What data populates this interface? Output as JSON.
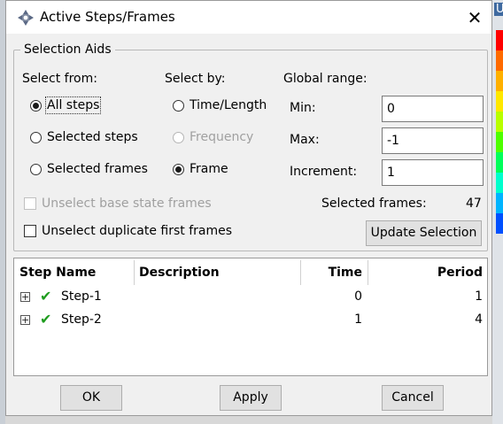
{
  "colors": {
    "accent": "#3f6aa0",
    "check_green": "#1f9d1f"
  },
  "background": {
    "partial_label": "U",
    "legend_colors": [
      "#ff0000",
      "#ff6a00",
      "#ffb000",
      "#ffe800",
      "#b8ff00",
      "#4dff00",
      "#00ff5a",
      "#00ffcc",
      "#00b4ff",
      "#0050ff"
    ]
  },
  "dialog": {
    "title": "Active Steps/Frames",
    "title_icon": "abaqus-app-icon",
    "close_icon": "close-icon",
    "group_title": "Selection Aids",
    "select_from": {
      "heading": "Select from:",
      "options": [
        {
          "label": "All steps",
          "checked": true
        },
        {
          "label": "Selected steps",
          "checked": false
        },
        {
          "label": "Selected frames",
          "checked": false
        }
      ]
    },
    "select_by": {
      "heading": "Select by:",
      "options": [
        {
          "label": "Time/Length",
          "checked": false,
          "enabled": true
        },
        {
          "label": "Frequency",
          "checked": false,
          "enabled": false
        },
        {
          "label": "Frame",
          "checked": true,
          "enabled": true
        }
      ]
    },
    "global_range": {
      "heading": "Global range:",
      "min_label": "Min:",
      "min_value": "0",
      "max_label": "Max:",
      "max_value": "-1",
      "increment_label": "Increment:",
      "increment_value": "1"
    },
    "unselect_base": {
      "label": "Unselect base state frames",
      "checked": false,
      "enabled": false
    },
    "unselect_duplicate": {
      "label": "Unselect duplicate first frames",
      "checked": false
    },
    "selected_frames_label": "Selected frames:",
    "selected_frames_count": "47",
    "update_button": "Update Selection",
    "table": {
      "columns": [
        "Step Name",
        "Description",
        "Time",
        "Period"
      ],
      "rows": [
        {
          "name": "Step-1",
          "description": "",
          "time": "0",
          "period": "1"
        },
        {
          "name": "Step-2",
          "description": "",
          "time": "1",
          "period": "4"
        }
      ]
    },
    "buttons": {
      "ok": "OK",
      "apply": "Apply",
      "cancel": "Cancel"
    }
  }
}
